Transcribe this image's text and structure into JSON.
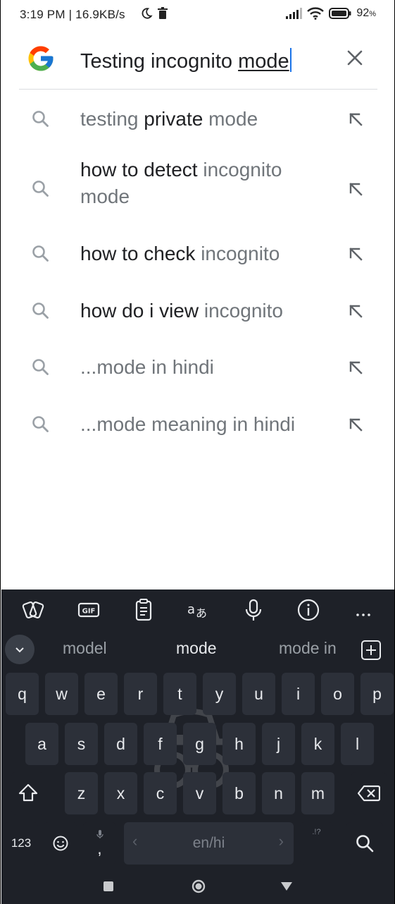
{
  "status_bar": {
    "time": "3:19 PM | 16.9KB/s",
    "battery": "92",
    "icons": [
      "moon-icon",
      "delete-icon",
      "signal-icon",
      "wifi-icon",
      "battery-icon"
    ]
  },
  "search": {
    "query_plain": "Testing incognito ",
    "query_underlined": "mode",
    "clear_icon": "close-icon"
  },
  "suggestions": [
    {
      "parts": [
        {
          "t": "testing ",
          "dim": true
        },
        {
          "t": "private",
          "dim": false
        },
        {
          "t": " mode",
          "dim": true
        }
      ]
    },
    {
      "parts": [
        {
          "t": "how to detect ",
          "dim": false
        },
        {
          "t": "incognito mode",
          "dim": true
        }
      ]
    },
    {
      "parts": [
        {
          "t": "how to check ",
          "dim": false
        },
        {
          "t": "incognito",
          "dim": true
        }
      ]
    },
    {
      "parts": [
        {
          "t": "how do i view ",
          "dim": false
        },
        {
          "t": "incognito",
          "dim": true
        }
      ]
    },
    {
      "parts": [
        {
          "t": "...mode in hindi",
          "dim": true
        }
      ]
    },
    {
      "parts": [
        {
          "t": "...mode meaning in hindi",
          "dim": true
        }
      ]
    }
  ],
  "keyboard": {
    "toolbar_icons": [
      "stickers-icon",
      "gif-icon",
      "clipboard-icon",
      "translate-icon",
      "microphone-icon",
      "info-icon",
      "more-icon"
    ],
    "word_suggestions": [
      "model",
      "mode",
      "mode in"
    ],
    "row1": [
      "q",
      "w",
      "e",
      "r",
      "t",
      "y",
      "u",
      "i",
      "o",
      "p"
    ],
    "row2": [
      "a",
      "s",
      "d",
      "f",
      "g",
      "h",
      "j",
      "k",
      "l"
    ],
    "row3": [
      "z",
      "x",
      "c",
      "v",
      "b",
      "n",
      "m"
    ],
    "numbers_key": "123",
    "comma_key": ",",
    "space_label": "en/hi",
    "punct_key": ".!?"
  },
  "colors": {
    "accent": "#1a73e8",
    "text": "#202124",
    "dim_text": "#70757a",
    "keyboard_bg": "#1e2128",
    "key_bg": "#2c3039"
  }
}
